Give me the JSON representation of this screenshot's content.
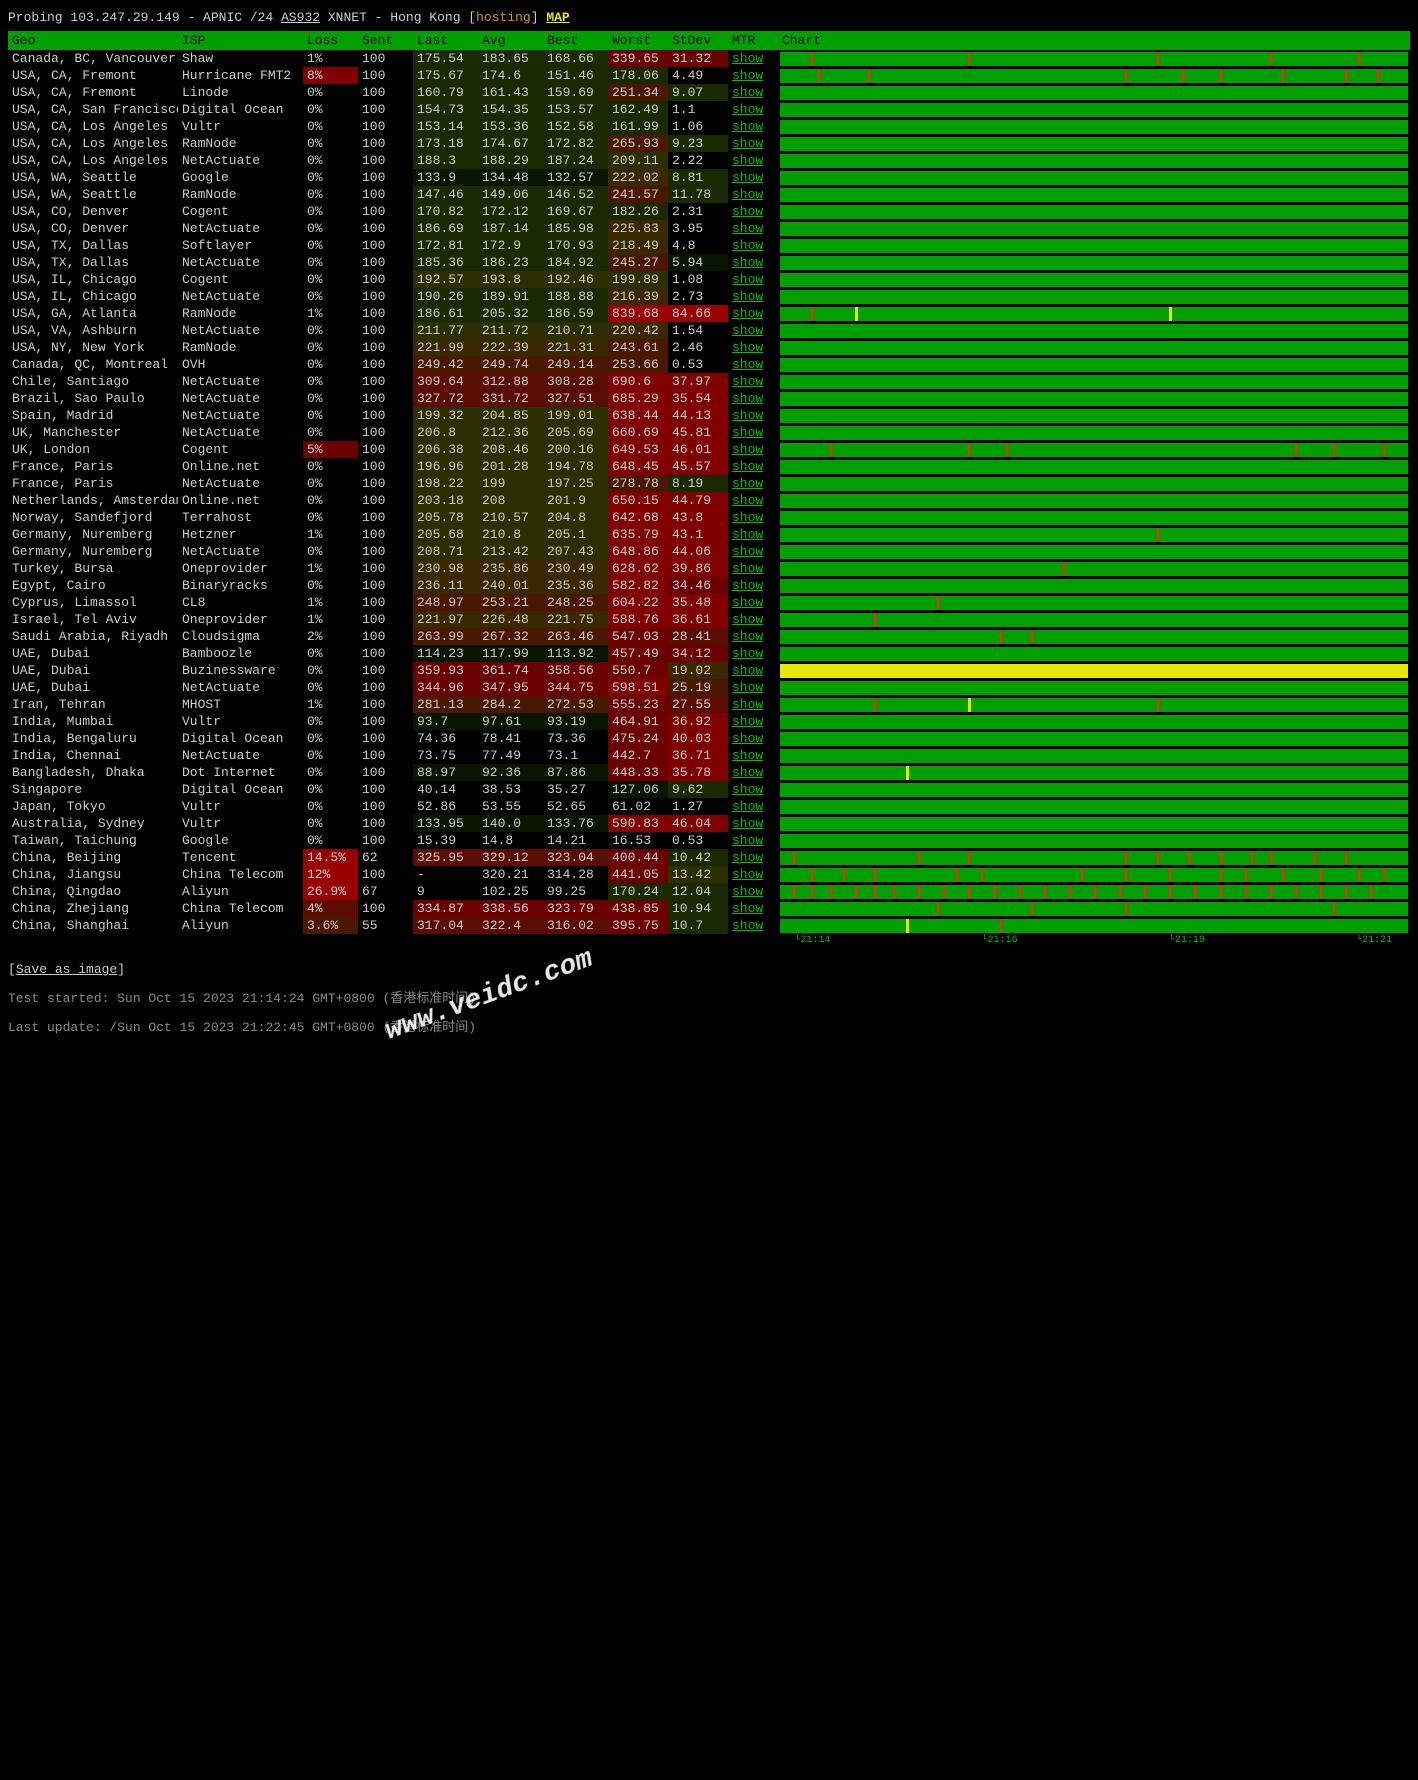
{
  "header": {
    "prefix": "Probing ",
    "ip": "103.247.29.149",
    "sep1": " - APNIC /24 ",
    "asn": "AS932",
    "sep2": " XNNET - Hong Kong [",
    "hosting": "hosting",
    "sep3": "] ",
    "map": "MAP"
  },
  "columns": [
    "Geo",
    "ISP",
    "Loss",
    "Sent",
    "Last",
    "Avg",
    "Best",
    "Worst",
    "StDev",
    "MTR",
    "Chart"
  ],
  "mtr_label": "show",
  "rows": [
    {
      "geo": "Canada, BC, Vancouver",
      "isp": "Shaw",
      "loss": "1%",
      "sent": "100",
      "last": "175.54",
      "avg": "183.65",
      "best": "168.66",
      "worst": "339.65",
      "stdev": "31.32",
      "lh": 2,
      "wh": 7,
      "sh": 7,
      "ticks": [
        5,
        30,
        60,
        78,
        92
      ],
      "yticks": []
    },
    {
      "geo": "USA, CA, Fremont",
      "isp": "Hurricane FMT2",
      "loss": "8%",
      "sent": "100",
      "last": "175.67",
      "avg": "174.6",
      "best": "151.46",
      "worst": "178.06",
      "stdev": "4.49",
      "lh": 2,
      "wh": 2,
      "sh": 0,
      "lossh": 8,
      "ticks": [
        6,
        14,
        55,
        64,
        70,
        80,
        90,
        95
      ],
      "yticks": []
    },
    {
      "geo": "USA, CA, Fremont",
      "isp": "Linode",
      "loss": "0%",
      "sent": "100",
      "last": "160.79",
      "avg": "161.43",
      "best": "159.69",
      "worst": "251.34",
      "stdev": "9.07",
      "lh": 2,
      "wh": 5,
      "sh": 2,
      "ticks": [],
      "yticks": []
    },
    {
      "geo": "USA, CA, San Francisco",
      "isp": "Digital Ocean",
      "loss": "0%",
      "sent": "100",
      "last": "154.73",
      "avg": "154.35",
      "best": "153.57",
      "worst": "162.49",
      "stdev": "1.1",
      "lh": 2,
      "wh": 2,
      "sh": 0,
      "ticks": [],
      "yticks": []
    },
    {
      "geo": "USA, CA, Los Angeles",
      "isp": "Vultr",
      "loss": "0%",
      "sent": "100",
      "last": "153.14",
      "avg": "153.36",
      "best": "152.58",
      "worst": "161.99",
      "stdev": "1.06",
      "lh": 2,
      "wh": 2,
      "sh": 0,
      "ticks": [],
      "yticks": []
    },
    {
      "geo": "USA, CA, Los Angeles",
      "isp": "RamNode",
      "loss": "0%",
      "sent": "100",
      "last": "173.18",
      "avg": "174.67",
      "best": "172.82",
      "worst": "265.93",
      "stdev": "9.23",
      "lh": 2,
      "wh": 5,
      "sh": 2,
      "ticks": [],
      "yticks": []
    },
    {
      "geo": "USA, CA, Los Angeles",
      "isp": "NetActuate",
      "loss": "0%",
      "sent": "100",
      "last": "188.3",
      "avg": "188.29",
      "best": "187.24",
      "worst": "209.11",
      "stdev": "2.22",
      "lh": 2,
      "wh": 3,
      "sh": 0,
      "ticks": [],
      "yticks": []
    },
    {
      "geo": "USA, WA, Seattle",
      "isp": "Google",
      "loss": "0%",
      "sent": "100",
      "last": "133.9",
      "avg": "134.48",
      "best": "132.57",
      "worst": "222.02",
      "stdev": "8.81",
      "lh": 1,
      "wh": 4,
      "sh": 2,
      "ticks": [],
      "yticks": []
    },
    {
      "geo": "USA, WA, Seattle",
      "isp": "RamNode",
      "loss": "0%",
      "sent": "100",
      "last": "147.46",
      "avg": "149.06",
      "best": "146.52",
      "worst": "241.57",
      "stdev": "11.78",
      "lh": 2,
      "wh": 5,
      "sh": 2,
      "ticks": [],
      "yticks": []
    },
    {
      "geo": "USA, CO, Denver",
      "isp": "Cogent",
      "loss": "0%",
      "sent": "100",
      "last": "170.82",
      "avg": "172.12",
      "best": "169.67",
      "worst": "182.26",
      "stdev": "2.31",
      "lh": 2,
      "wh": 2,
      "sh": 0,
      "ticks": [],
      "yticks": []
    },
    {
      "geo": "USA, CO, Denver",
      "isp": "NetActuate",
      "loss": "0%",
      "sent": "100",
      "last": "186.69",
      "avg": "187.14",
      "best": "185.98",
      "worst": "225.83",
      "stdev": "3.95",
      "lh": 2,
      "wh": 4,
      "sh": 0,
      "ticks": [],
      "yticks": []
    },
    {
      "geo": "USA, TX, Dallas",
      "isp": "Softlayer",
      "loss": "0%",
      "sent": "100",
      "last": "172.81",
      "avg": "172.9",
      "best": "170.93",
      "worst": "218.49",
      "stdev": "4.8",
      "lh": 2,
      "wh": 4,
      "sh": 0,
      "ticks": [],
      "yticks": []
    },
    {
      "geo": "USA, TX, Dallas",
      "isp": "NetActuate",
      "loss": "0%",
      "sent": "100",
      "last": "185.36",
      "avg": "186.23",
      "best": "184.92",
      "worst": "245.27",
      "stdev": "5.94",
      "lh": 2,
      "wh": 5,
      "sh": 1,
      "ticks": [],
      "yticks": []
    },
    {
      "geo": "USA, IL, Chicago",
      "isp": "Cogent",
      "loss": "0%",
      "sent": "100",
      "last": "192.57",
      "avg": "193.8",
      "best": "192.46",
      "worst": "199.89",
      "stdev": "1.08",
      "lh": 3,
      "wh": 3,
      "sh": 0,
      "ticks": [],
      "yticks": []
    },
    {
      "geo": "USA, IL, Chicago",
      "isp": "NetActuate",
      "loss": "0%",
      "sent": "100",
      "last": "190.26",
      "avg": "189.91",
      "best": "188.88",
      "worst": "216.39",
      "stdev": "2.73",
      "lh": 2,
      "wh": 4,
      "sh": 0,
      "ticks": [],
      "yticks": []
    },
    {
      "geo": "USA, GA, Atlanta",
      "isp": "RamNode",
      "loss": "1%",
      "sent": "100",
      "last": "186.61",
      "avg": "205.32",
      "best": "186.59",
      "worst": "839.68",
      "stdev": "84.66",
      "lh": 2,
      "wh": 9,
      "sh": 9,
      "ticks": [
        5
      ],
      "yticks": [
        12,
        62
      ]
    },
    {
      "geo": "USA, VA, Ashburn",
      "isp": "NetActuate",
      "loss": "0%",
      "sent": "100",
      "last": "211.77",
      "avg": "211.72",
      "best": "210.71",
      "worst": "220.42",
      "stdev": "1.54",
      "lh": 3,
      "wh": 4,
      "sh": 0,
      "ticks": [],
      "yticks": []
    },
    {
      "geo": "USA, NY, New York",
      "isp": "RamNode",
      "loss": "0%",
      "sent": "100",
      "last": "221.99",
      "avg": "222.39",
      "best": "221.31",
      "worst": "243.61",
      "stdev": "2.46",
      "lh": 4,
      "wh": 5,
      "sh": 0,
      "ticks": [],
      "yticks": []
    },
    {
      "geo": "Canada, QC, Montreal",
      "isp": "OVH",
      "loss": "0%",
      "sent": "100",
      "last": "249.42",
      "avg": "249.74",
      "best": "249.14",
      "worst": "253.66",
      "stdev": "0.53",
      "lh": 5,
      "wh": 5,
      "sh": 0,
      "ticks": [],
      "yticks": []
    },
    {
      "geo": "Chile, Santiago",
      "isp": "NetActuate",
      "loss": "0%",
      "sent": "100",
      "last": "309.64",
      "avg": "312.88",
      "best": "308.28",
      "worst": "690.6",
      "stdev": "37.97",
      "lh": 6,
      "wh": 8,
      "sh": 8,
      "ticks": [],
      "yticks": []
    },
    {
      "geo": "Brazil, Sao Paulo",
      "isp": "NetActuate",
      "loss": "0%",
      "sent": "100",
      "last": "327.72",
      "avg": "331.72",
      "best": "327.51",
      "worst": "685.29",
      "stdev": "35.54",
      "lh": 6,
      "wh": 8,
      "sh": 8,
      "ticks": [],
      "yticks": []
    },
    {
      "geo": "Spain, Madrid",
      "isp": "NetActuate",
      "loss": "0%",
      "sent": "100",
      "last": "199.32",
      "avg": "204.85",
      "best": "199.01",
      "worst": "638.44",
      "stdev": "44.13",
      "lh": 3,
      "wh": 8,
      "sh": 8,
      "ticks": [],
      "yticks": []
    },
    {
      "geo": "UK, Manchester",
      "isp": "NetActuate",
      "loss": "0%",
      "sent": "100",
      "last": "206.8",
      "avg": "212.36",
      "best": "205.69",
      "worst": "660.69",
      "stdev": "45.81",
      "lh": 3,
      "wh": 8,
      "sh": 8,
      "ticks": [],
      "yticks": []
    },
    {
      "geo": "UK, London",
      "isp": "Cogent",
      "loss": "5%",
      "sent": "100",
      "last": "206.38",
      "avg": "208.46",
      "best": "200.16",
      "worst": "649.53",
      "stdev": "46.01",
      "lh": 3,
      "wh": 8,
      "sh": 8,
      "lossh": 7,
      "ticks": [
        8,
        30,
        36,
        82,
        88,
        96
      ],
      "yticks": []
    },
    {
      "geo": "France, Paris",
      "isp": "Online.net",
      "loss": "0%",
      "sent": "100",
      "last": "196.96",
      "avg": "201.28",
      "best": "194.78",
      "worst": "648.45",
      "stdev": "45.57",
      "lh": 3,
      "wh": 8,
      "sh": 8,
      "ticks": [],
      "yticks": []
    },
    {
      "geo": "France, Paris",
      "isp": "NetActuate",
      "loss": "0%",
      "sent": "100",
      "last": "198.22",
      "avg": "199",
      "best": "197.25",
      "worst": "278.78",
      "stdev": "8.19",
      "lh": 3,
      "wh": 5,
      "sh": 2,
      "ticks": [],
      "yticks": []
    },
    {
      "geo": "Netherlands, Amsterdam",
      "isp": "Online.net",
      "loss": "0%",
      "sent": "100",
      "last": "203.18",
      "avg": "208",
      "best": "201.9",
      "worst": "650.15",
      "stdev": "44.79",
      "lh": 3,
      "wh": 8,
      "sh": 8,
      "ticks": [],
      "yticks": []
    },
    {
      "geo": "Norway, Sandefjord",
      "isp": "Terrahost",
      "loss": "0%",
      "sent": "100",
      "last": "205.78",
      "avg": "210.57",
      "best": "204.8",
      "worst": "642.68",
      "stdev": "43.8",
      "lh": 3,
      "wh": 8,
      "sh": 8,
      "ticks": [],
      "yticks": []
    },
    {
      "geo": "Germany, Nuremberg",
      "isp": "Hetzner",
      "loss": "1%",
      "sent": "100",
      "last": "205.68",
      "avg": "210.8",
      "best": "205.1",
      "worst": "635.79",
      "stdev": "43.1",
      "lh": 3,
      "wh": 8,
      "sh": 8,
      "ticks": [
        60
      ],
      "yticks": []
    },
    {
      "geo": "Germany, Nuremberg",
      "isp": "NetActuate",
      "loss": "0%",
      "sent": "100",
      "last": "208.71",
      "avg": "213.42",
      "best": "207.43",
      "worst": "648.86",
      "stdev": "44.06",
      "lh": 3,
      "wh": 8,
      "sh": 8,
      "ticks": [],
      "yticks": []
    },
    {
      "geo": "Turkey, Bursa",
      "isp": "Oneprovider",
      "loss": "1%",
      "sent": "100",
      "last": "230.98",
      "avg": "235.86",
      "best": "230.49",
      "worst": "628.62",
      "stdev": "39.86",
      "lh": 4,
      "wh": 8,
      "sh": 8,
      "ticks": [
        45
      ],
      "yticks": []
    },
    {
      "geo": "Egypt, Cairo",
      "isp": "Binaryracks",
      "loss": "0%",
      "sent": "100",
      "last": "236.11",
      "avg": "240.01",
      "best": "235.36",
      "worst": "582.82",
      "stdev": "34.46",
      "lh": 4,
      "wh": 8,
      "sh": 7,
      "ticks": [],
      "yticks": []
    },
    {
      "geo": "Cyprus, Limassol",
      "isp": "CL8",
      "loss": "1%",
      "sent": "100",
      "last": "248.97",
      "avg": "253.21",
      "best": "248.25",
      "worst": "604.22",
      "stdev": "35.48",
      "lh": 5,
      "wh": 8,
      "sh": 8,
      "ticks": [
        25
      ],
      "yticks": []
    },
    {
      "geo": "Israel, Tel Aviv",
      "isp": "Oneprovider",
      "loss": "1%",
      "sent": "100",
      "last": "221.97",
      "avg": "226.48",
      "best": "221.75",
      "worst": "588.76",
      "stdev": "36.61",
      "lh": 4,
      "wh": 8,
      "sh": 8,
      "ticks": [
        15
      ],
      "yticks": []
    },
    {
      "geo": "Saudi Arabia, Riyadh",
      "isp": "Cloudsigma",
      "loss": "2%",
      "sent": "100",
      "last": "263.99",
      "avg": "267.32",
      "best": "263.46",
      "worst": "547.03",
      "stdev": "28.41",
      "lh": 5,
      "wh": 7,
      "sh": 6,
      "ticks": [
        35,
        40
      ],
      "yticks": []
    },
    {
      "geo": "UAE, Dubai",
      "isp": "Bamboozle",
      "loss": "0%",
      "sent": "100",
      "last": "114.23",
      "avg": "117.99",
      "best": "113.92",
      "worst": "457.49",
      "stdev": "34.12",
      "lh": 1,
      "wh": 7,
      "sh": 7,
      "ticks": [],
      "yticks": []
    },
    {
      "geo": "UAE, Dubai",
      "isp": "Buzinessware",
      "loss": "0%",
      "sent": "100",
      "last": "359.93",
      "avg": "361.74",
      "best": "358.56",
      "worst": "550.7",
      "stdev": "19.02",
      "lh": 7,
      "wh": 7,
      "sh": 4,
      "ticks": [],
      "yticks": [],
      "chartbg": "yellow"
    },
    {
      "geo": "UAE, Dubai",
      "isp": "NetActuate",
      "loss": "0%",
      "sent": "100",
      "last": "344.96",
      "avg": "347.95",
      "best": "344.75",
      "worst": "598.51",
      "stdev": "25.19",
      "lh": 7,
      "wh": 8,
      "sh": 5,
      "ticks": [],
      "yticks": []
    },
    {
      "geo": "Iran, Tehran",
      "isp": "MHOST",
      "loss": "1%",
      "sent": "100",
      "last": "281.13",
      "avg": "284.2",
      "best": "272.53",
      "worst": "555.23",
      "stdev": "27.55",
      "lh": 5,
      "wh": 7,
      "sh": 6,
      "ticks": [
        15,
        60
      ],
      "yticks": [
        30
      ]
    },
    {
      "geo": "India, Mumbai",
      "isp": "Vultr",
      "loss": "0%",
      "sent": "100",
      "last": "93.7",
      "avg": "97.61",
      "best": "93.19",
      "worst": "464.91",
      "stdev": "36.92",
      "lh": 1,
      "wh": 7,
      "sh": 8,
      "ticks": [],
      "yticks": []
    },
    {
      "geo": "India, Bengaluru",
      "isp": "Digital Ocean",
      "loss": "0%",
      "sent": "100",
      "last": "74.36",
      "avg": "78.41",
      "best": "73.36",
      "worst": "475.24",
      "stdev": "40.03",
      "lh": 0,
      "wh": 7,
      "sh": 8,
      "ticks": [],
      "yticks": []
    },
    {
      "geo": "India, Chennai",
      "isp": "NetActuate",
      "loss": "0%",
      "sent": "100",
      "last": "73.75",
      "avg": "77.49",
      "best": "73.1",
      "worst": "442.7",
      "stdev": "36.71",
      "lh": 0,
      "wh": 7,
      "sh": 8,
      "ticks": [],
      "yticks": []
    },
    {
      "geo": "Bangladesh, Dhaka",
      "isp": "Dot Internet",
      "loss": "0%",
      "sent": "100",
      "last": "88.97",
      "avg": "92.36",
      "best": "87.86",
      "worst": "448.33",
      "stdev": "35.78",
      "lh": 1,
      "wh": 7,
      "sh": 8,
      "ticks": [],
      "yticks": [
        20
      ]
    },
    {
      "geo": "Singapore",
      "isp": "Digital Ocean",
      "loss": "0%",
      "sent": "100",
      "last": "40.14",
      "avg": "38.53",
      "best": "35.27",
      "worst": "127.06",
      "stdev": "9.62",
      "lh": 0,
      "wh": 1,
      "sh": 2,
      "ticks": [],
      "yticks": []
    },
    {
      "geo": "Japan, Tokyo",
      "isp": "Vultr",
      "loss": "0%",
      "sent": "100",
      "last": "52.86",
      "avg": "53.55",
      "best": "52.65",
      "worst": "61.02",
      "stdev": "1.27",
      "lh": 0,
      "wh": 0,
      "sh": 0,
      "ticks": [],
      "yticks": []
    },
    {
      "geo": "Australia, Sydney",
      "isp": "Vultr",
      "loss": "0%",
      "sent": "100",
      "last": "133.95",
      "avg": "140.0",
      "best": "133.76",
      "worst": "590.83",
      "stdev": "46.04",
      "lh": 1,
      "wh": 8,
      "sh": 8,
      "ticks": [],
      "yticks": []
    },
    {
      "geo": "Taiwan, Taichung",
      "isp": "Google",
      "loss": "0%",
      "sent": "100",
      "last": "15.39",
      "avg": "14.8",
      "best": "14.21",
      "worst": "16.53",
      "stdev": "0.53",
      "lh": 0,
      "wh": 0,
      "sh": 0,
      "ticks": [],
      "yticks": []
    },
    {
      "geo": "China, Beijing",
      "isp": "Tencent",
      "loss": "14.5%",
      "sent": "62",
      "last": "325.95",
      "avg": "329.12",
      "best": "323.04",
      "worst": "400.44",
      "stdev": "10.42",
      "lh": 6,
      "wh": 7,
      "sh": 2,
      "lossh": 9,
      "ticks": [
        2,
        22,
        30,
        55,
        60,
        65,
        70,
        75,
        78,
        85,
        90
      ],
      "yticks": []
    },
    {
      "geo": "China, Jiangsu",
      "isp": "China Telecom",
      "loss": "12%",
      "sent": "100",
      "last": "-",
      "avg": "320.21",
      "best": "314.28",
      "worst": "441.05",
      "stdev": "13.42",
      "lh": 0,
      "wh": 7,
      "sh": 3,
      "lossh": 9,
      "ticks": [
        5,
        10,
        15,
        28,
        32,
        48,
        55,
        62,
        70,
        74,
        80,
        86,
        92,
        96
      ],
      "yticks": []
    },
    {
      "geo": "China, Qingdao",
      "isp": "Aliyun",
      "loss": "26.9%",
      "sent": "67",
      "last": "9",
      "avg": "102.25",
      "best": "99.25",
      "worst": "170.24",
      "stdev": "12.04",
      "lh": 0,
      "wh": 2,
      "sh": 2,
      "lossh": 9,
      "ticks": [
        2,
        5,
        8,
        12,
        15,
        18,
        22,
        26,
        30,
        34,
        38,
        42,
        46,
        50,
        54,
        58,
        62,
        66,
        70,
        74,
        78,
        82,
        86,
        90,
        94
      ],
      "yticks": []
    },
    {
      "geo": "China, Zhejiang",
      "isp": "China Telecom",
      "loss": "4%",
      "sent": "100",
      "last": "334.87",
      "avg": "338.56",
      "best": "323.79",
      "worst": "438.85",
      "stdev": "10.94",
      "lh": 7,
      "wh": 7,
      "sh": 2,
      "lossh": 6,
      "ticks": [
        25,
        40,
        55,
        88
      ],
      "yticks": []
    },
    {
      "geo": "China, Shanghai",
      "isp": "Aliyun",
      "loss": "3.6%",
      "sent": "55",
      "last": "317.04",
      "avg": "322.4",
      "best": "316.02",
      "worst": "395.75",
      "stdev": "10.7",
      "lh": 6,
      "wh": 7,
      "sh": 2,
      "lossh": 5,
      "ticks": [
        35
      ],
      "yticks": [
        20
      ]
    }
  ],
  "timeaxis": [
    {
      "label": "21:14",
      "pos": 2
    },
    {
      "label": "21:16",
      "pos": 32
    },
    {
      "label": "21:19",
      "pos": 62
    },
    {
      "label": "21:21",
      "pos": 92
    }
  ],
  "footer": {
    "save": "Save as image",
    "started_label": "Test started: ",
    "started_value": "Sun Oct 15 2023 21:14:24 GMT+0800",
    "started_tz": " (香港标准时间)",
    "updated_label": "Last update: /",
    "updated_value": "Sun Oct 15 2023 21:22:45 GMT+0800",
    "updated_tz": " (香港标准时间)"
  },
  "watermark": "www.veidc.com"
}
